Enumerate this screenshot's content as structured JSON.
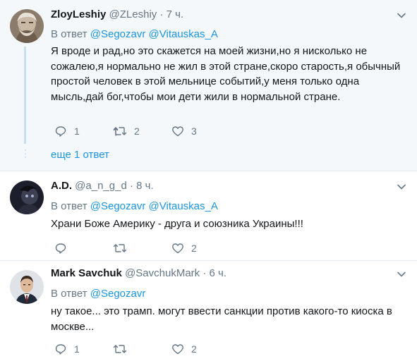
{
  "tweets": [
    {
      "name": "ZloyLeshiy",
      "handle": "@ZLeshiy",
      "time": "7 ч.",
      "reply_prefix": "В ответ",
      "mentions": [
        "@Segozavr",
        "@Vitauskas_A"
      ],
      "text": "Я вроде и рад,но это скажется на моей жизни,но я нисколько не сожалею,я нормально не жил в этой стране,скоро старость,я обычный простой человек в этой мельнице событий,у меня только одна мысль,дай бог,чтобы мои дети жили в нормальной стране.",
      "replies": "1",
      "retweets": "2",
      "likes": "3"
    },
    {
      "name": "A.D.",
      "handle": "@a_n_g_d",
      "time": "8 ч.",
      "reply_prefix": "В ответ",
      "mentions": [
        "@Segozavr",
        "@Vitauskas_A"
      ],
      "text": "Храни Боже Америку - друга и союзника Украины!!!",
      "replies": "",
      "retweets": "",
      "likes": "2"
    },
    {
      "name": "Mark Savchuk",
      "handle": "@SavchukMark",
      "time": "6 ч.",
      "reply_prefix": "В ответ",
      "mentions": [
        "@Segozavr"
      ],
      "text": "ну такое... это трамп. могут ввести санкции против какого-то киоска в москве...",
      "replies": "1",
      "retweets": "",
      "likes": "2"
    }
  ],
  "more_replies": "еще 1 ответ",
  "separator": "·",
  "colors": {
    "link": "#1b95e0",
    "muted": "#657786",
    "thread_bg": "#f5f8fa",
    "thread_line": "#c4e0f2"
  },
  "icons": [
    "reply-icon",
    "retweet-icon",
    "like-icon",
    "chevron-down-icon"
  ]
}
